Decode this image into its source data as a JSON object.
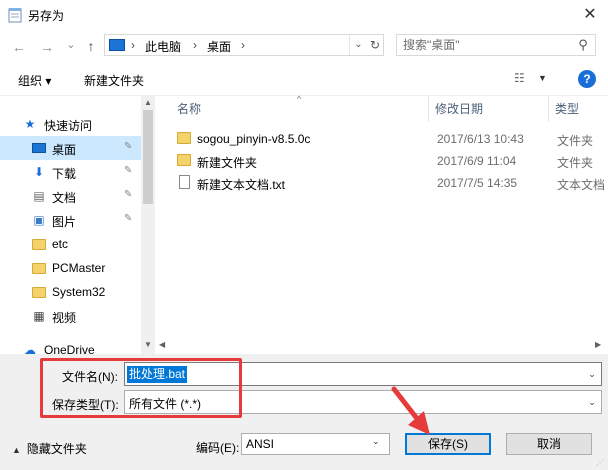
{
  "window": {
    "title": "另存为",
    "close_glyph": "✕"
  },
  "nav": {
    "back_glyph": "←",
    "forward_glyph": "→",
    "recent_glyph": "⌄",
    "up_glyph": "↑",
    "breadcrumb": [
      "此电脑",
      "桌面"
    ],
    "breadcrumb_sep": "›",
    "refresh_glyph": "↻",
    "search_placeholder": "搜索\"桌面\""
  },
  "toolbar": {
    "organize_label": "组织 ▾",
    "new_folder_label": "新建文件夹",
    "view_glyph": "☷",
    "view_dd_glyph": "▼",
    "help_glyph": "?"
  },
  "sidebar": {
    "items": [
      {
        "label": "快速访问",
        "icon": "star-icon",
        "glyph": "★"
      },
      {
        "label": "桌面",
        "icon": "desktop-icon",
        "glyph": "",
        "pinned": true,
        "selected": true
      },
      {
        "label": "下载",
        "icon": "download-icon",
        "glyph": "⬇",
        "pinned": true
      },
      {
        "label": "文档",
        "icon": "document-icon",
        "glyph": "▤",
        "pinned": true
      },
      {
        "label": "图片",
        "icon": "picture-icon",
        "glyph": "▣",
        "pinned": true
      },
      {
        "label": "etc",
        "icon": "folder-icon"
      },
      {
        "label": "PCMaster",
        "icon": "folder-icon"
      },
      {
        "label": "System32",
        "icon": "folder-icon"
      },
      {
        "label": "视频",
        "icon": "video-icon",
        "glyph": "▦"
      },
      {
        "label": "OneDrive",
        "icon": "cloud-icon",
        "glyph": "☁"
      }
    ],
    "pin_glyph": "📌"
  },
  "filelist": {
    "columns": {
      "name": "名称",
      "date": "修改日期",
      "type": "类型"
    },
    "sort_glyph": "^",
    "rows": [
      {
        "name": "sogou_pinyin-v8.5.0c",
        "date": "2017/6/13 10:43",
        "type": "文件夹",
        "icon": "folder-icon"
      },
      {
        "name": "新建文件夹",
        "date": "2017/6/9 11:04",
        "type": "文件夹",
        "icon": "folder-icon"
      },
      {
        "name": "新建文本文档.txt",
        "date": "2017/7/5 14:35",
        "type": "文本文档",
        "icon": "text-file-icon"
      }
    ]
  },
  "form": {
    "filename_label": "文件名(N):",
    "filename_value": "批处理.bat",
    "filetype_label": "保存类型(T):",
    "filetype_value": "所有文件  (*.*)",
    "hide_folders_label": "隐藏文件夹",
    "encoding_label": "编码(E):",
    "encoding_value": "ANSI",
    "save_label": "保存(S)",
    "cancel_label": "取消",
    "dd_glyph": "⌄"
  },
  "colors": {
    "accent": "#0078d7",
    "highlight": "#e63b3b",
    "selected_bg": "#cce8ff"
  }
}
